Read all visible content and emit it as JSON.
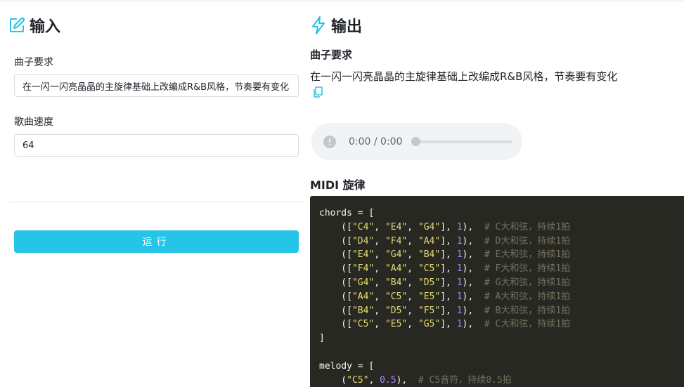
{
  "input_panel": {
    "title": "输入",
    "requirement_label": "曲子要求",
    "requirement_value": "在一闪一闪亮晶晶的主旋律基础上改编成R&B风格，节奏要有变化",
    "speed_label": "歌曲速度",
    "speed_value": "64",
    "run_label": "运行"
  },
  "output_panel": {
    "title": "输出",
    "requirement_label": "曲子要求",
    "requirement_value": "在一闪一闪亮晶晶的主旋律基础上改编成R&B风格，节奏要有变化",
    "audio_time": "0:00 / 0:00",
    "audio_progress": 0,
    "midi_label": "MIDI 旋律",
    "code": {
      "chords_open": "chords = [",
      "chords": [
        {
          "notes": [
            "C4",
            "E4",
            "G4"
          ],
          "dur": "1",
          "comment": "# C大和弦，持续1拍"
        },
        {
          "notes": [
            "D4",
            "F4",
            "A4"
          ],
          "dur": "1",
          "comment": "# D大和弦，持续1拍"
        },
        {
          "notes": [
            "E4",
            "G4",
            "B4"
          ],
          "dur": "1",
          "comment": "# E大和弦，持续1拍"
        },
        {
          "notes": [
            "F4",
            "A4",
            "C5"
          ],
          "dur": "1",
          "comment": "# F大和弦，持续1拍"
        },
        {
          "notes": [
            "G4",
            "B4",
            "D5"
          ],
          "dur": "1",
          "comment": "# G大和弦，持续1拍"
        },
        {
          "notes": [
            "A4",
            "C5",
            "E5"
          ],
          "dur": "1",
          "comment": "# A大和弦，持续1拍"
        },
        {
          "notes": [
            "B4",
            "D5",
            "F5"
          ],
          "dur": "1",
          "comment": "# B大和弦，持续1拍"
        },
        {
          "notes": [
            "C5",
            "E5",
            "G5"
          ],
          "dur": "1",
          "comment": "# C大和弦，持续1拍"
        }
      ],
      "chords_close": "]",
      "melody_open": "melody = [",
      "melody": [
        {
          "note": "C5",
          "dur": "0.5",
          "comment": "# C5音符，持续0.5拍"
        }
      ]
    }
  },
  "colors": {
    "accent": "#26c4e6",
    "code_bg": "#272822"
  },
  "icons": {
    "input_title": "edit-icon",
    "output_title": "lightning-icon",
    "copy": "copy-icon",
    "audio_play": "play-disabled-icon"
  }
}
